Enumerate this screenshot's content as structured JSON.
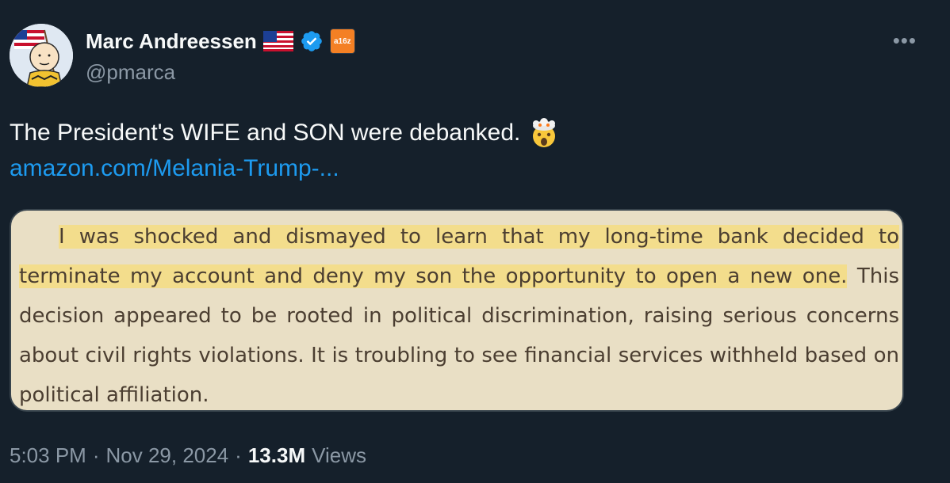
{
  "author": {
    "name": "Marc Andreessen",
    "handle": "@pmarca",
    "badge_text": "a16z"
  },
  "icons": {
    "avatar": "charlie-brown-with-flag-avatar",
    "flag": "us-flag-icon",
    "verified": "verified-check-icon",
    "more": "more-options-icon",
    "emoji": "exploding-head-emoji"
  },
  "tweet": {
    "text": "The President's WIFE and SON were debanked.",
    "link": "amazon.com/Melania-Trump-..."
  },
  "excerpt": {
    "highlighted": "I was shocked and dismayed to learn that my long-time bank decided to terminate my account and deny my son the opportunity to open a new one.",
    "rest": " This decision appeared to be rooted in political discrimination, raising serious concerns about civil rights violations. It is troubling to see financial services withheld based on political affiliation."
  },
  "meta": {
    "time": "5:03 PM",
    "date": "Nov 29, 2024",
    "views_count": "13.3M",
    "views_label": "Views"
  },
  "colors": {
    "background": "#15202b",
    "link": "#1d9bf0",
    "secondary": "#8b98a5",
    "card_bg": "#e9dfc5",
    "highlight": "#f3dd8c",
    "verified": "#1d9bf0",
    "badge": "#f48024"
  }
}
